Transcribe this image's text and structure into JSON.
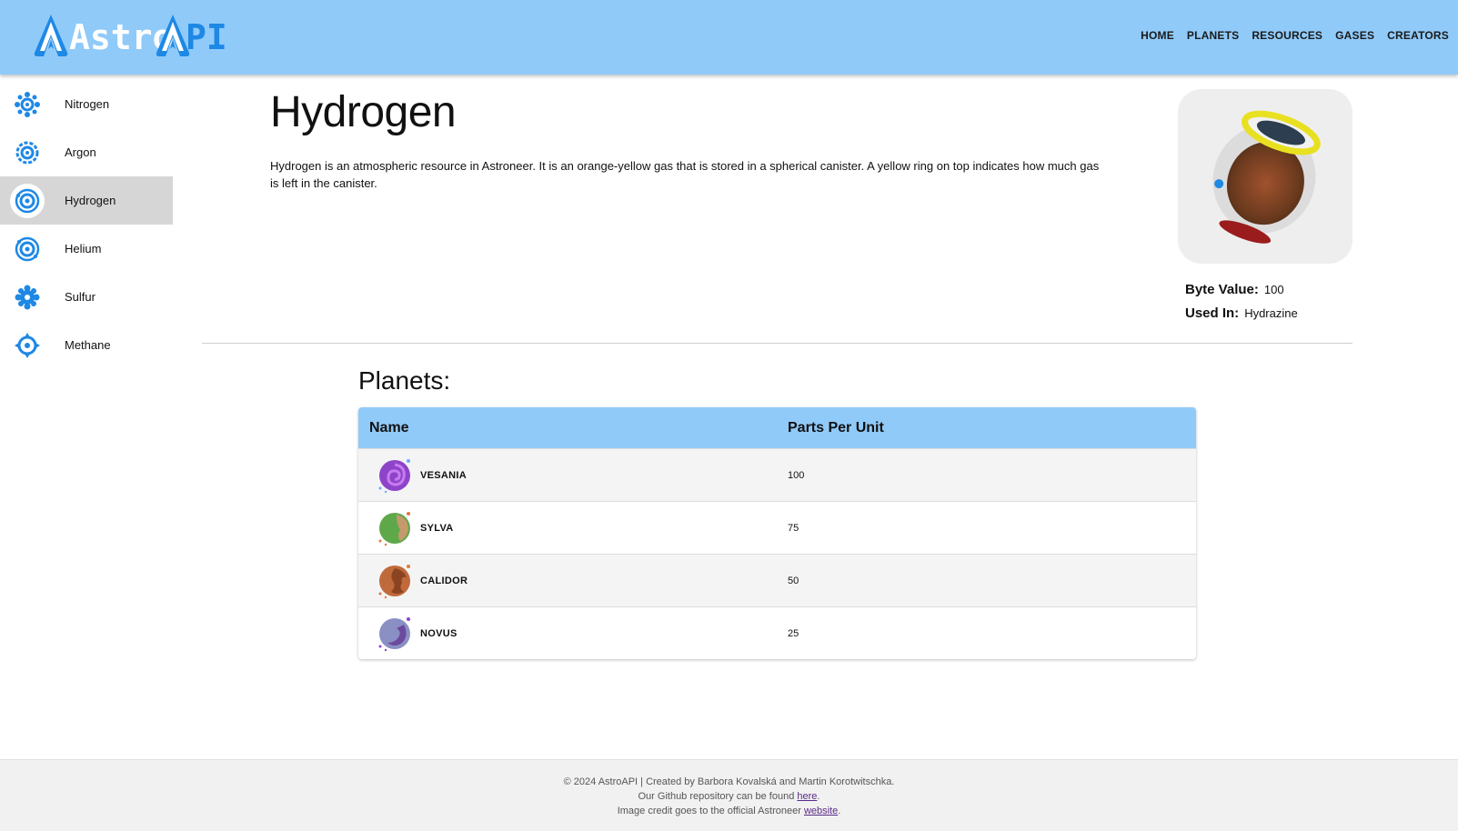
{
  "header": {
    "logo_left": "Astro",
    "logo_right": "API",
    "nav": [
      "HOME",
      "PLANETS",
      "RESOURCES",
      "GASES",
      "CREATORS"
    ]
  },
  "sidebar": {
    "items": [
      {
        "label": "Nitrogen",
        "icon": "nitrogen-icon",
        "active": false
      },
      {
        "label": "Argon",
        "icon": "argon-icon",
        "active": false
      },
      {
        "label": "Hydrogen",
        "icon": "hydrogen-icon",
        "active": true
      },
      {
        "label": "Helium",
        "icon": "helium-icon",
        "active": false
      },
      {
        "label": "Sulfur",
        "icon": "sulfur-icon",
        "active": false
      },
      {
        "label": "Methane",
        "icon": "methane-icon",
        "active": false
      }
    ]
  },
  "resource": {
    "title": "Hydrogen",
    "description": "Hydrogen is an atmospheric resource in Astroneer. It is an orange-yellow gas that is stored in a spherical canister. A yellow ring on top indicates how much gas is left in the canister.",
    "byte_label": "Byte Value:",
    "byte_value": "100",
    "used_label": "Used In:",
    "used_value": "Hydrazine",
    "image": "hydrogen-canister-image"
  },
  "planets": {
    "title": "Planets:",
    "col_name": "Name",
    "col_ppu": "Parts Per Unit",
    "rows": [
      {
        "name": "VESANIA",
        "ppu": "100",
        "icon": "vesania-planet-icon",
        "color": "#8e44c9"
      },
      {
        "name": "SYLVA",
        "ppu": "75",
        "icon": "sylva-planet-icon",
        "color": "#5fa84a"
      },
      {
        "name": "CALIDOR",
        "ppu": "50",
        "icon": "calidor-planet-icon",
        "color": "#c0693a"
      },
      {
        "name": "NOVUS",
        "ppu": "25",
        "icon": "novus-planet-icon",
        "color": "#8a8fc4"
      }
    ]
  },
  "footer": {
    "line1": "© 2024 AstroAPI | Created by Barbora Kovalská and Martin Korotwitschka.",
    "line2_pre": "Our Github repository can be found ",
    "line2_link": "here",
    "line2_post": ".",
    "line3_pre": "Image credit goes to the official Astroneer ",
    "line3_link": "website",
    "line3_post": "."
  },
  "colors": {
    "header_bg": "#90caf9",
    "accent": "#1e88e5",
    "active_item_bg": "#d6d6d6"
  }
}
